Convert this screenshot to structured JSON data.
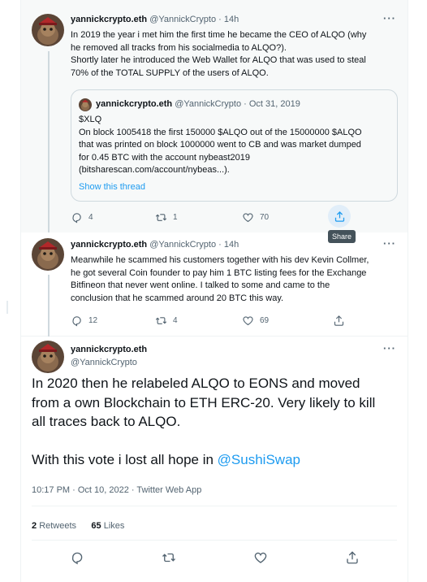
{
  "colors": {
    "accent": "#1d9bf0",
    "text": "#0f1419",
    "muted": "#536471"
  },
  "tweets": [
    {
      "display_name": "yannickcrypto.eth",
      "handle": "@YannickCrypto",
      "time": "· 14h",
      "more": "···",
      "lines": [
        "In 2019 the year i met him the first time he became the CEO of ALQO (why",
        "he removed all tracks from his socialmedia to ALQO?).",
        "Shortly later he introduced the Web Wallet for ALQO that was used to steal",
        "70% of the TOTAL SUPPLY of the users of ALQO."
      ],
      "quote": {
        "display_name": "yannickcrypto.eth",
        "handle": "@YannickCrypto",
        "time": "· Oct 31, 2019",
        "lines": [
          "$XLQ",
          "On block 1005418 the first 150000 $ALQO out of the 15000000 $ALQO",
          "that was printed on block 1000000 went to CB and was market dumped",
          "for 0.45 BTC with the account nybeast2019",
          "(bitsharescan.com/account/nybeas...)."
        ],
        "show_thread": "Show this thread"
      },
      "reply_count": "4",
      "retweet_count": "1",
      "like_count": "70",
      "share_tooltip": "Share"
    },
    {
      "display_name": "yannickcrypto.eth",
      "handle": "@YannickCrypto",
      "time": "· 14h",
      "more": "···",
      "lines": [
        "Meanwhile he scammed his customers together with his dev Kevin Collmer,",
        "he got several Coin founder to pay him 1 BTC listing fees for the Exchange",
        "Bitfineon that never went online. I talked to some and came to the",
        "conclusion that he scammed around 20 BTC this way."
      ],
      "reply_count": "12",
      "retweet_count": "4",
      "like_count": "69"
    }
  ],
  "main_tweet": {
    "display_name": "yannickcrypto.eth",
    "handle": "@YannickCrypto",
    "more": "···",
    "lines": [
      "In 2020 then he relabeled ALQO to EONS and moved",
      "from a own Blockchain to ETH ERC-20. Very likely to kill",
      "all traces back to ALQO."
    ],
    "line4_prefix": "With this vote i lost all hope in ",
    "mention": "@SushiSwap",
    "meta": "10:17 PM · Oct 10, 2022 · Twitter Web App",
    "retweets_count": "2",
    "retweets_label": "Retweets",
    "likes_count": "65",
    "likes_label": "Likes"
  },
  "icons": [
    "reply-icon",
    "retweet-icon",
    "like-icon",
    "share-icon",
    "more-icon"
  ]
}
